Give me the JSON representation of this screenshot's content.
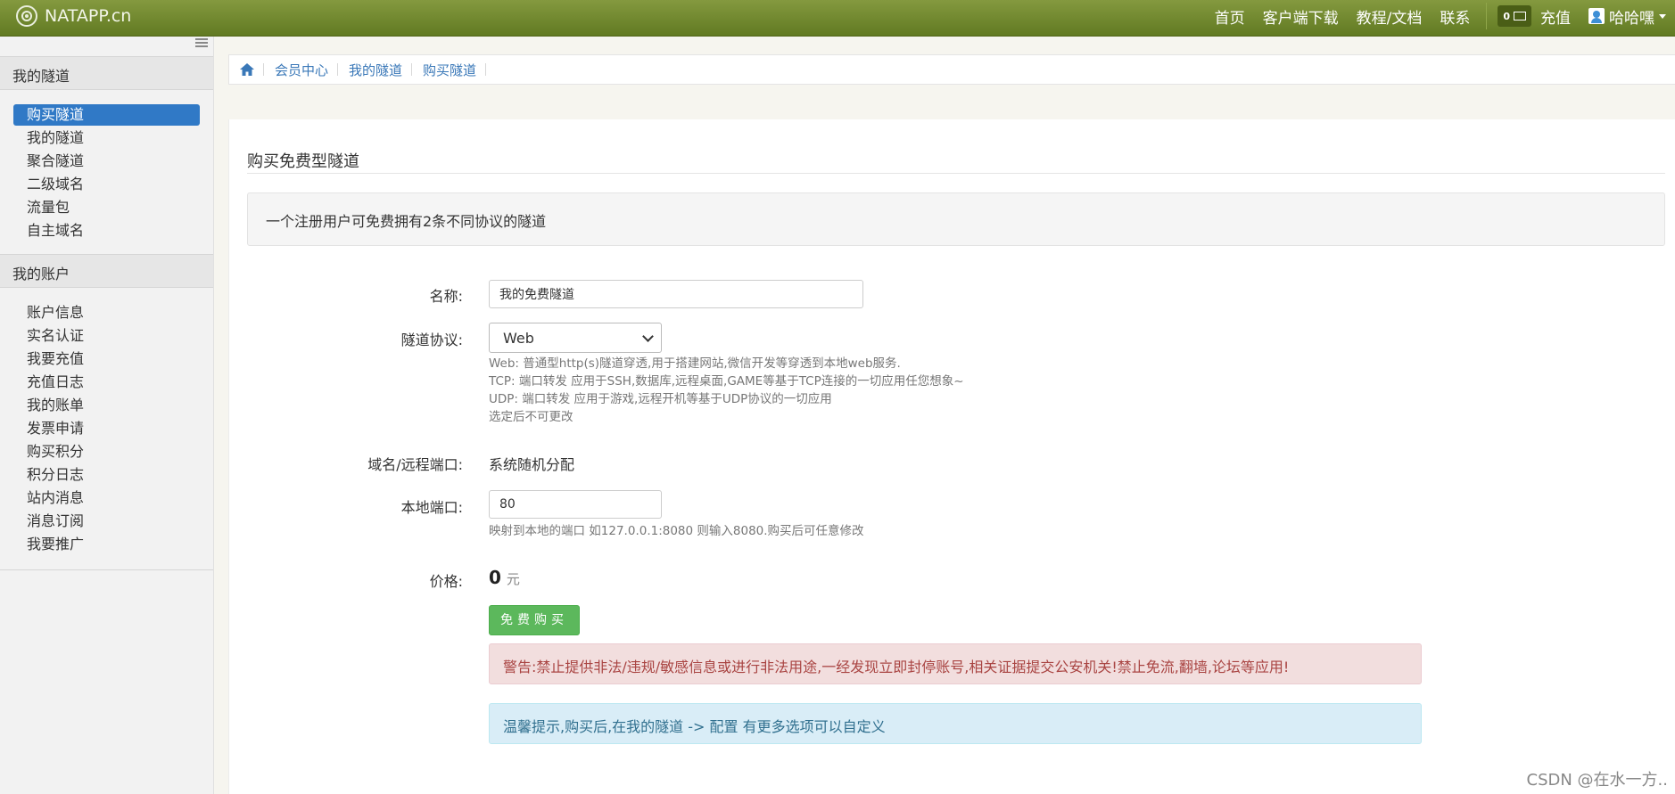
{
  "brand": {
    "name": "NATAPP.cn"
  },
  "topnav": {
    "links": [
      "首页",
      "客户端下载",
      "教程/文档",
      "联系"
    ],
    "message_count": "0",
    "recharge": "充值",
    "user": "哈哈嘿"
  },
  "sidebar": {
    "tunnels_section": "我的隧道",
    "tunnel_items": [
      "购买隧道",
      "我的隧道",
      "聚合隧道",
      "二级域名",
      "流量包",
      "自主域名"
    ],
    "account_section": "我的账户",
    "account_items": [
      "账户信息",
      "实名认证",
      "我要充值",
      "充值日志",
      "我的账单",
      "发票申请",
      "购买积分",
      "积分日志",
      "站内消息",
      "消息订阅",
      "我要推广"
    ]
  },
  "breadcrumb": [
    "会员中心",
    "我的隧道",
    "购买隧道"
  ],
  "panel": {
    "title": "购买免费型隧道",
    "notice": "一个注册用户可免费拥有2条不同协议的隧道"
  },
  "form": {
    "name_label": "名称:",
    "name_value": "我的免费隧道",
    "protocol_label": "隧道协议:",
    "protocol_value": "Web",
    "protocol_help": [
      "Web: 普通型http(s)隧道穿透,用于搭建网站,微信开发等穿透到本地web服务.",
      "TCP: 端口转发 应用于SSH,数据库,远程桌面,GAME等基于TCP连接的一切应用任您想象~",
      "UDP: 端口转发 应用于游戏,远程开机等基于UDP协议的一切应用",
      "选定后不可更改"
    ],
    "domain_label": "域名/远程端口:",
    "domain_value": "系统随机分配",
    "local_port_label": "本地端口:",
    "local_port_value": "80",
    "local_port_help": "映射到本地的端口 如127.0.0.1:8080 则输入8080.购买后可任意修改",
    "price_label": "价格:",
    "price_value": "0",
    "price_unit": "元",
    "buy_button": "免费购买"
  },
  "alerts": {
    "warning": "警告:禁止提供非法/违规/敏感信息或进行非法用途,一经发现立即封停账号,相关证据提交公安机关!禁止免流,翻墙,论坛等应用!",
    "tip": "温馨提示,购买后,在我的隧道 -> 配置 有更多选项可以自定义"
  },
  "watermark": "CSDN @在水一方.."
}
